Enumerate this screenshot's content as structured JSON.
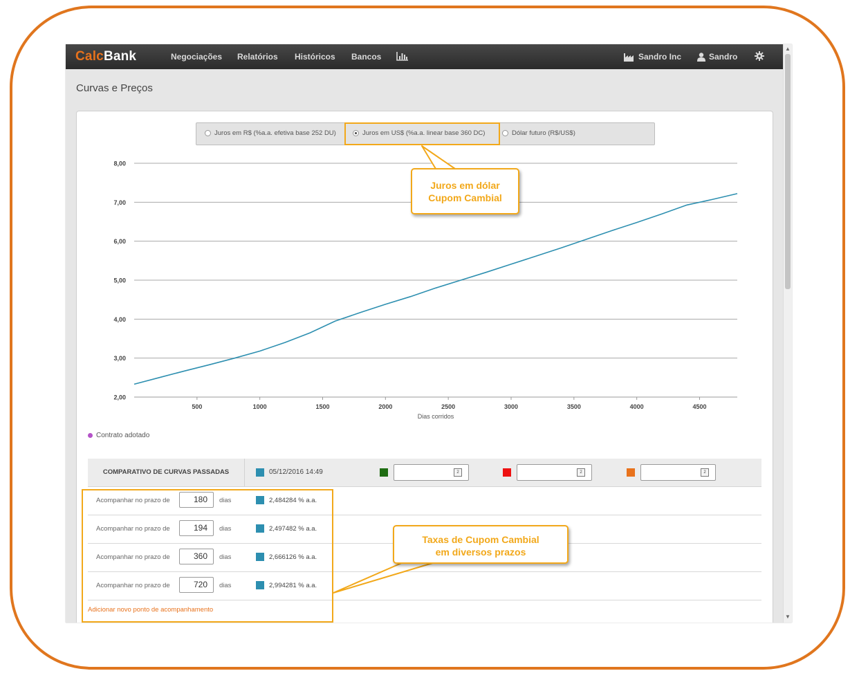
{
  "app": {
    "brand_part1": "Calc",
    "brand_part2": "Bank",
    "nav": [
      "Negociações",
      "Relatórios",
      "Históricos",
      "Bancos"
    ],
    "chart_icon": "bar-chart-icon",
    "company_icon": "factory-icon",
    "company": "Sandro Inc",
    "user_icon": "user-icon",
    "user": "Sandro",
    "settings_icon": "gear-icon",
    "accent_color": "#e8721c"
  },
  "page": {
    "title": "Curvas e Preços"
  },
  "curve_selector": {
    "options": [
      {
        "label": "Juros em R$ (%a.a. efetiva base 252 DU)",
        "selected": false
      },
      {
        "label": "Juros em US$ (%a.a. linear base 360 DC)",
        "selected": true
      },
      {
        "label": "Dólar futuro (R$/US$)",
        "selected": false
      }
    ]
  },
  "chart_data": {
    "type": "line",
    "xlabel": "Dias corridos",
    "ylabel": "",
    "xlim": [
      0,
      4800
    ],
    "ylim": [
      2,
      8
    ],
    "x_ticks": [
      500,
      1000,
      1500,
      2000,
      2500,
      3000,
      3500,
      4000,
      4500
    ],
    "x_tick_labels": [
      "500",
      "1000",
      "1500",
      "2000",
      "2500",
      "3000",
      "3500",
      "4000",
      "4500"
    ],
    "y_ticks": [
      2,
      3,
      4,
      5,
      6,
      7,
      8
    ],
    "y_tick_labels": [
      "2,00",
      "3,00",
      "4,00",
      "5,00",
      "6,00",
      "7,00",
      "8,00"
    ],
    "grid": true,
    "legend_position": "bottom-left",
    "series": [
      {
        "name": "Contrato adotado",
        "color": "#2d8fb0",
        "x": [
          0,
          200,
          400,
          600,
          800,
          1000,
          1200,
          1400,
          1600,
          1800,
          2000,
          2200,
          2400,
          2600,
          2800,
          3000,
          3200,
          3400,
          3600,
          3800,
          4000,
          4200,
          4400,
          4600,
          4800
        ],
        "y": [
          2.33,
          2.5,
          2.67,
          2.83,
          3.0,
          3.18,
          3.4,
          3.65,
          3.95,
          4.17,
          4.38,
          4.58,
          4.8,
          5.0,
          5.2,
          5.41,
          5.62,
          5.83,
          6.05,
          6.27,
          6.48,
          6.7,
          6.93,
          7.07,
          7.22
        ]
      }
    ],
    "legend_color": "#b453c8"
  },
  "comparison": {
    "title": "COMPARATIVO DE CURVAS PASSADAS",
    "current_date": "05/12/2016 14:49",
    "current_color": "#2d8fb0",
    "date_slots": [
      {
        "color": "#1e6c12",
        "value": ""
      },
      {
        "color": "#ee1111",
        "value": ""
      },
      {
        "color": "#e8721c",
        "value": ""
      }
    ],
    "calendar_icon": "calendar-icon",
    "calendar_glyph": "2"
  },
  "tracking": {
    "label": "Acompanhar no prazo de",
    "unit": "dias",
    "rows": [
      {
        "days": "180",
        "rate": "2,484284 % a.a."
      },
      {
        "days": "194",
        "rate": "2,497482 % a.a."
      },
      {
        "days": "360",
        "rate": "2,666126 % a.a."
      },
      {
        "days": "720",
        "rate": "2,994281 % a.a."
      }
    ],
    "add_link": "Adicionar novo ponto de acompanhamento"
  },
  "annotations": {
    "callout1_line1": "Juros em dólar",
    "callout1_line2": "Cupom Cambial",
    "callout2_line1": "Taxas de Cupom Cambial",
    "callout2_line2": "em diversos prazos",
    "color": "#f2a81a"
  }
}
